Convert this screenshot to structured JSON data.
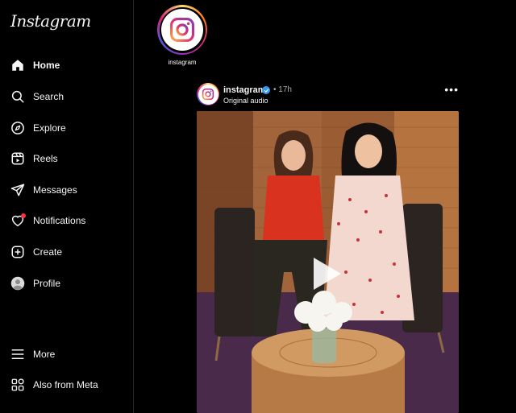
{
  "app": {
    "logo_text": "Instagram"
  },
  "sidebar": {
    "items": [
      {
        "label": "Home",
        "icon": "home-icon",
        "active": true
      },
      {
        "label": "Search",
        "icon": "search-icon"
      },
      {
        "label": "Explore",
        "icon": "compass-icon"
      },
      {
        "label": "Reels",
        "icon": "reels-icon"
      },
      {
        "label": "Messages",
        "icon": "send-icon"
      },
      {
        "label": "Notifications",
        "icon": "heart-icon",
        "badge": true
      },
      {
        "label": "Create",
        "icon": "plus-square-icon"
      },
      {
        "label": "Profile",
        "icon": "avatar-icon"
      }
    ],
    "bottom_items": [
      {
        "label": "More",
        "icon": "menu-icon"
      },
      {
        "label": "Also from Meta",
        "icon": "meta-apps-icon"
      }
    ]
  },
  "stories": [
    {
      "username": "instagram"
    }
  ],
  "post": {
    "username": "instagram",
    "verified": true,
    "separator": "•",
    "time": "17h",
    "audio": "Original audio",
    "more_label": "•••",
    "media_type": "video",
    "colors": {
      "wall": "#9a5a30",
      "floor": "#4a2a4a",
      "left_dress": "#d9321f",
      "right_dress": "#f2d8cf",
      "table": "#c88a50"
    }
  },
  "colors": {
    "background": "#000000",
    "text": "#f5f5f5",
    "muted": "#a8a8a8",
    "verified": "#3897f0",
    "notification_dot": "#ff3040"
  }
}
